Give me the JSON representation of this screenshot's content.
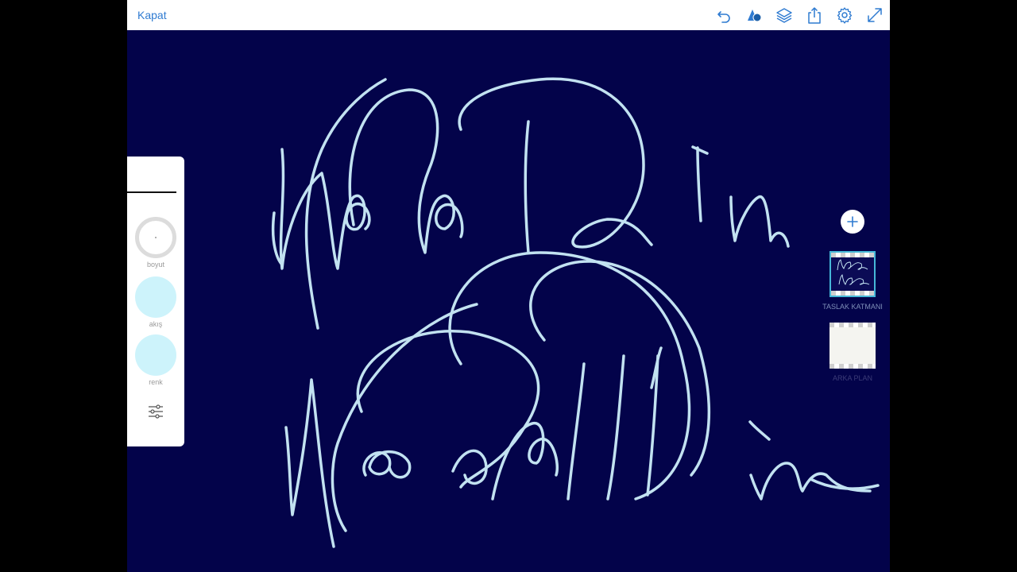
{
  "topbar": {
    "close_label": "Kapat",
    "icons": [
      "undo-icon",
      "shape-icon",
      "layers-icon",
      "share-icon",
      "gear-icon",
      "fullscreen-icon"
    ]
  },
  "tool_panel": {
    "size_label": "boyut",
    "flow_label": "akış",
    "color_label": "renk",
    "current_color": "#cdf3fb"
  },
  "layers": {
    "items": [
      {
        "label": "TASLAK KATMANI",
        "selected": true
      },
      {
        "label": "ARKA PLAN",
        "selected": false
      }
    ]
  },
  "colors": {
    "canvas_bg": "#03034a",
    "stroke": "#cdeefa",
    "accent": "#2f7bd1"
  }
}
